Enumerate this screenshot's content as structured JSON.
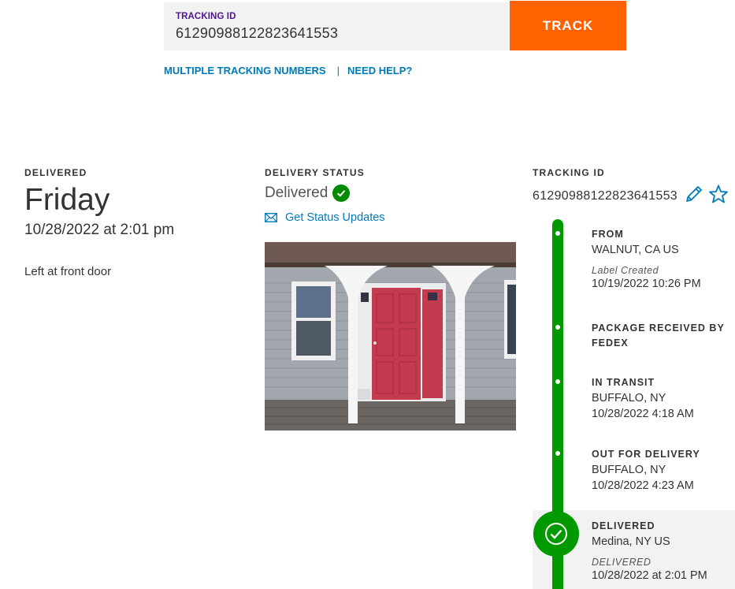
{
  "search": {
    "label": "TRACKING ID",
    "value": "61290988122823641553",
    "button": "TRACK"
  },
  "links": {
    "multiple": "MULTIPLE TRACKING NUMBERS",
    "separator": "|",
    "help": "NEED HELP?"
  },
  "delivered": {
    "caption": "DELIVERED",
    "day": "Friday",
    "datetime": "10/28/2022 at 2:01 pm",
    "note": "Left at front door"
  },
  "status": {
    "caption": "DELIVERY STATUS",
    "value": "Delivered",
    "updates_link": "Get Status Updates"
  },
  "tracking": {
    "caption": "TRACKING ID",
    "number": "61290988122823641553"
  },
  "timeline": {
    "from": {
      "title": "FROM",
      "location": "WALNUT, CA US",
      "sub": "Label Created",
      "time": "10/19/2022 10:26 PM"
    },
    "received": {
      "title_line1": "PACKAGE RECEIVED BY",
      "title_line2": "FEDEX"
    },
    "transit": {
      "title": "IN TRANSIT",
      "location": "BUFFALO, NY",
      "time": "10/28/2022 4:18 AM"
    },
    "out": {
      "title": "OUT FOR DELIVERY",
      "location": "BUFFALO, NY",
      "time": "10/28/2022 4:23 AM"
    },
    "final": {
      "title": "DELIVERED",
      "location": "Medina, NY US",
      "sub": "DELIVERED",
      "time": "10/28/2022 at 2:01 PM"
    }
  },
  "icons": {
    "status_check": "check-circle-icon",
    "mail": "envelope-icon",
    "edit": "pencil-icon",
    "favorite": "star-icon",
    "final_check": "check-circle-icon"
  },
  "colors": {
    "brand_purple": "#4d148c",
    "brand_orange": "#ff6200",
    "link_blue": "#007ab7",
    "progress_green": "#009900"
  }
}
